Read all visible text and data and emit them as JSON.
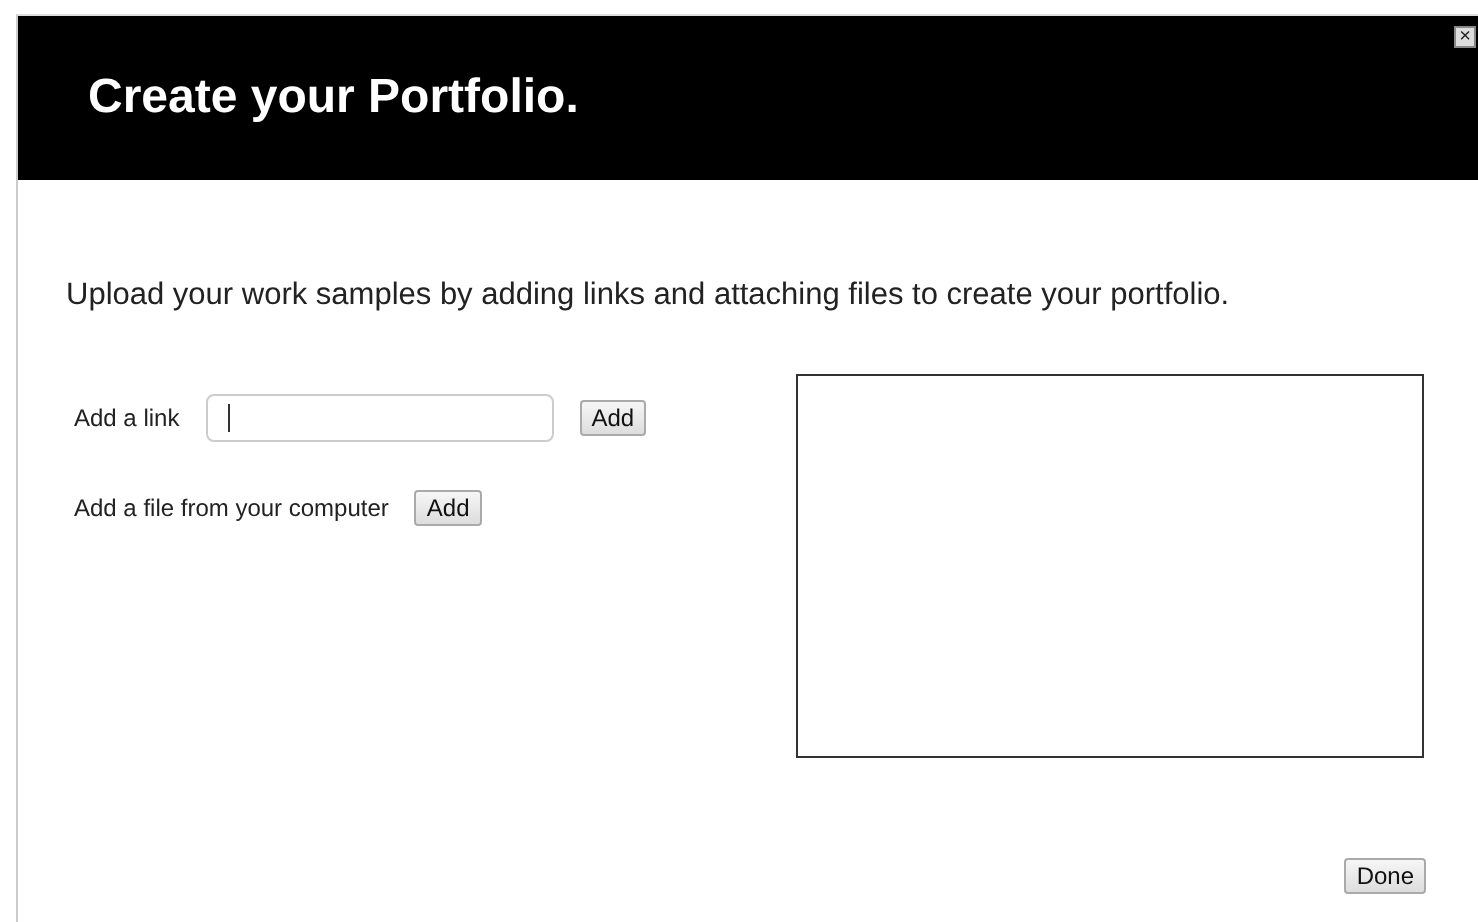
{
  "dialog": {
    "title": "Create your Portfolio.",
    "close_label": "×"
  },
  "intro": "Upload your work samples by adding links and attaching files to create your portfolio.",
  "link_row": {
    "label": "Add a link",
    "button": "Add"
  },
  "file_row": {
    "label": "Add a file from your computer",
    "button": "Add"
  },
  "done_button": "Done"
}
